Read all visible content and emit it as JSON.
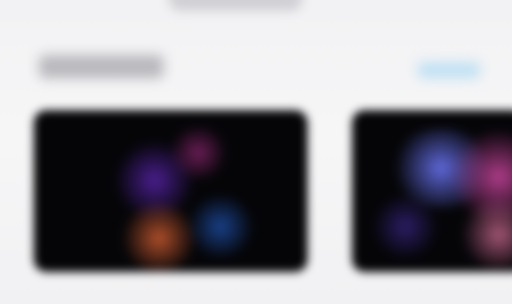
{
  "window": {
    "top_control_label": ""
  },
  "section": {
    "title": "",
    "see_all_label": ""
  },
  "cards": [
    {
      "title": "",
      "colors": [
        "#4e2096",
        "#962878",
        "#cd5c30",
        "#1e50aa"
      ]
    },
    {
      "title": "",
      "colors": [
        "#646ee6",
        "#cd46a0",
        "#e678a0",
        "#3c288c"
      ]
    }
  ],
  "theme": {
    "background": "#f4f4f6",
    "card_background": "#050508",
    "accent": "#bfe0f4"
  }
}
